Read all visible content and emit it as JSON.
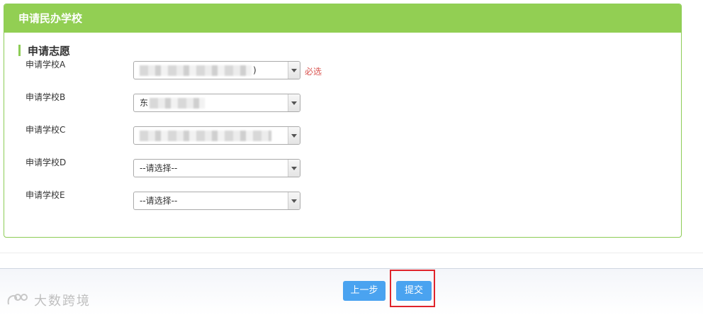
{
  "panel": {
    "title": "申请民办学校"
  },
  "section": {
    "title": "申请志愿"
  },
  "schools": [
    {
      "label": "申请学校A",
      "value": ")",
      "required_note": "必选"
    },
    {
      "label": "申请学校B",
      "value": "东"
    },
    {
      "label": "申请学校C",
      "value": ""
    },
    {
      "label": "申请学校D",
      "value": "--请选择--"
    },
    {
      "label": "申请学校E",
      "value": "--请选择--"
    }
  ],
  "footer": {
    "prev_label": "上一步",
    "submit_label": "提交"
  },
  "watermark": {
    "text": "大数跨境"
  },
  "colors": {
    "header_green": "#92cf53",
    "button_blue": "#4aa3f0",
    "required_red": "#d9534f",
    "highlight_red": "#e0242b"
  }
}
